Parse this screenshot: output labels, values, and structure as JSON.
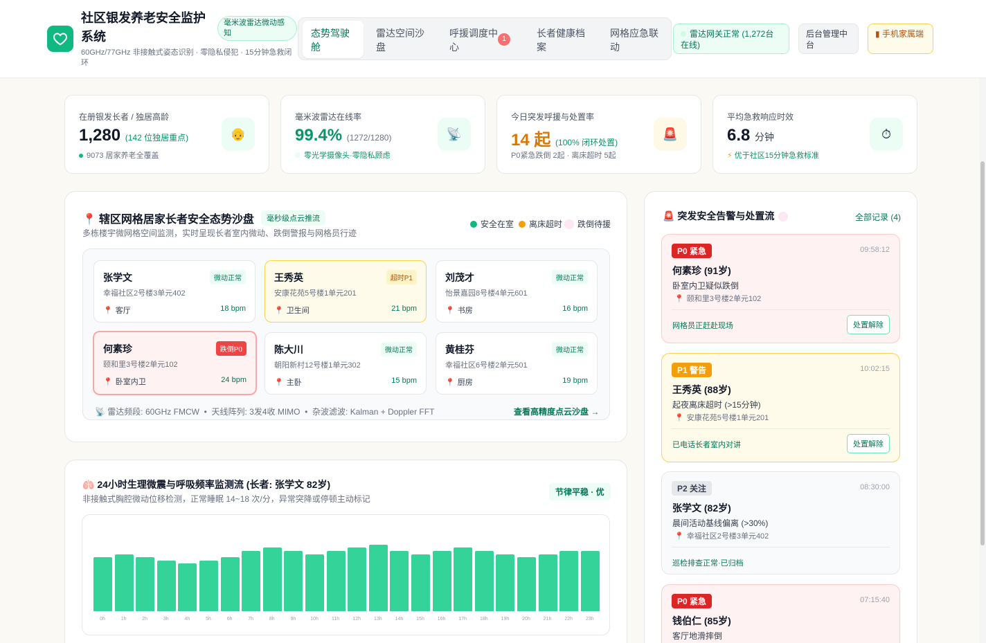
{
  "app": {
    "title": "社区银发养老安全监护系统",
    "tagline": "毫米波雷达微动感知",
    "subtitle": "60GHz/77GHz 非接触式姿态识别 · 零隐私侵犯 · 15分钟急救闭环"
  },
  "nav": {
    "tabs": [
      {
        "label": "态势驾驶舱"
      },
      {
        "label": "雷达空间沙盘"
      },
      {
        "label": "呼援调度中心",
        "badge": "1"
      },
      {
        "label": "长者健康档案"
      },
      {
        "label": "网格应急联动"
      }
    ]
  },
  "header_actions": {
    "gateway": "雷达网关正常 (1,272台在线)",
    "admin": "后台管理中台",
    "mobile": "手机家属端"
  },
  "stats": [
    {
      "label": "在册银发长者 / 独居高龄",
      "value": "1,280",
      "extra": "(142 位独居重点)",
      "note": "9073 居家养老全覆盖",
      "icon": "elder-icon"
    },
    {
      "label": "毫米波雷达在线率",
      "value": "99.4%",
      "extra": "(1272/1280)",
      "note": "零光学摄像头·零隐私顾虑",
      "icon": "radar-icon"
    },
    {
      "label": "今日突发呼援与处置率",
      "value": "14 起",
      "extra": "(100% 闭环处置)",
      "note": "P0紧急跌倒 2起 · 离床超时 5起",
      "icon": "siren-icon"
    },
    {
      "label": "平均急救响应时效",
      "value": "6.8",
      "extra": "分钟",
      "note": "优于社区15分钟急救标准",
      "icon": "stopwatch-icon"
    }
  ],
  "sandbox": {
    "title": "辖区网格居家长者安全态势沙盘",
    "tag": "毫秒级点云推流",
    "subtitle": "多栋楼宇微网格空间监测，实时呈现长者室内微动、跌倒警报与网格员行迹",
    "legend": [
      "安全在室",
      "离床超时",
      "跌倒待援"
    ],
    "cards": [
      {
        "name": "张学文",
        "status": "微动正常",
        "addr": "幸福社区2号楼3单元402",
        "room": "客厅",
        "bpm": "18 bpm"
      },
      {
        "name": "王秀英",
        "status": "超时P1",
        "addr": "安康花苑5号楼1单元201",
        "room": "卫生间",
        "bpm": "21 bpm"
      },
      {
        "name": "刘茂才",
        "status": "微动正常",
        "addr": "怡景嘉园8号楼4单元601",
        "room": "书房",
        "bpm": "16 bpm"
      },
      {
        "name": "何素珍",
        "status": "跌倒P0",
        "addr": "颐和里3号楼2单元102",
        "room": "卧室内卫",
        "bpm": "24 bpm"
      },
      {
        "name": "陈大川",
        "status": "微动正常",
        "addr": "朝阳新村12号楼1单元302",
        "room": "主卧",
        "bpm": "15 bpm"
      },
      {
        "name": "黄桂芬",
        "status": "微动正常",
        "addr": "幸福社区6号楼2单元501",
        "room": "厨房",
        "bpm": "19 bpm"
      }
    ],
    "radar_info": "雷达频段: 60GHz FMCW  •  天线阵列: 3发4收 MIMO  •  杂波滤波: Kalman + Doppler FFT",
    "link": "查看高精度点云沙盘 →"
  },
  "vitals": {
    "title": "24小时生理微震与呼吸频率监测流 (长者: 张学文 82岁)",
    "subtitle": "非接触式胸腔微动位移检测，正常睡眠 14~18 次/分，异常突降或停顿主动标记",
    "badge": "节律平稳 · 优"
  },
  "chart_data": {
    "type": "bar",
    "categories": [
      "0h",
      "1h",
      "2h",
      "3h",
      "4h",
      "5h",
      "6h",
      "7h",
      "8h",
      "9h",
      "10h",
      "11h",
      "12h",
      "13h",
      "14h",
      "15h",
      "16h",
      "17h",
      "18h",
      "19h",
      "20h",
      "21h",
      "22h",
      "23h"
    ],
    "values": [
      17,
      18,
      17,
      16,
      15,
      16,
      17,
      19,
      20,
      19,
      18,
      19,
      20,
      21,
      19,
      18,
      19,
      20,
      19,
      18,
      17,
      18,
      19,
      19
    ],
    "ylim": [
      0,
      24
    ]
  },
  "alerts": {
    "title": "突发安全告警与处置流",
    "link": "全部记录 (4)",
    "items": [
      {
        "level": "P0 紧急",
        "time": "09:58:12",
        "name": "何素珍 (91岁)",
        "desc": "卧室内卫疑似跌倒",
        "loc": "颐和里3号楼2单元102",
        "status": "网格员正赶赴现场",
        "action": "处置解除"
      },
      {
        "level": "P1 警告",
        "time": "10:02:15",
        "name": "王秀英 (88岁)",
        "desc": "起夜离床超时 (>15分钟)",
        "loc": "安康花苑5号楼1单元201",
        "status": "已电话长者室内对讲",
        "action": "处置解除"
      },
      {
        "level": "P2 关注",
        "time": "08:30:00",
        "name": "张学文 (82岁)",
        "desc": "晨间活动基线偏离 (>30%)",
        "loc": "幸福社区2号楼3单元402",
        "status": "巡检排查正常·已归档",
        "action": ""
      },
      {
        "level": "P0 紧急",
        "time": "07:15:40",
        "name": "钱伯仁 (85岁)",
        "desc": "客厅地滑摔倒",
        "loc": "",
        "status": "",
        "action": ""
      }
    ]
  }
}
